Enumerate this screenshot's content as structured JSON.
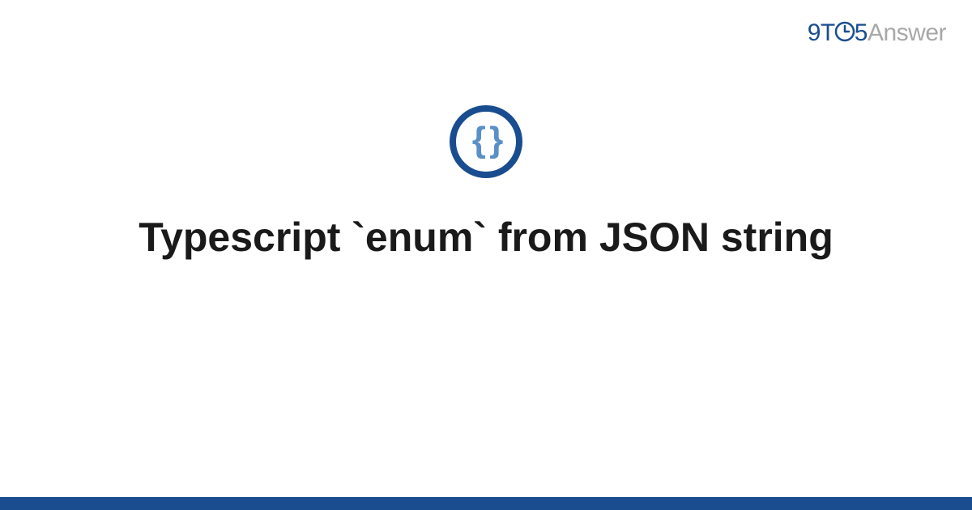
{
  "logo": {
    "part1": "9T",
    "part2": "5",
    "part3": "Answer"
  },
  "topic_icon": {
    "symbol": "{ }"
  },
  "title": "Typescript `enum` from JSON string"
}
